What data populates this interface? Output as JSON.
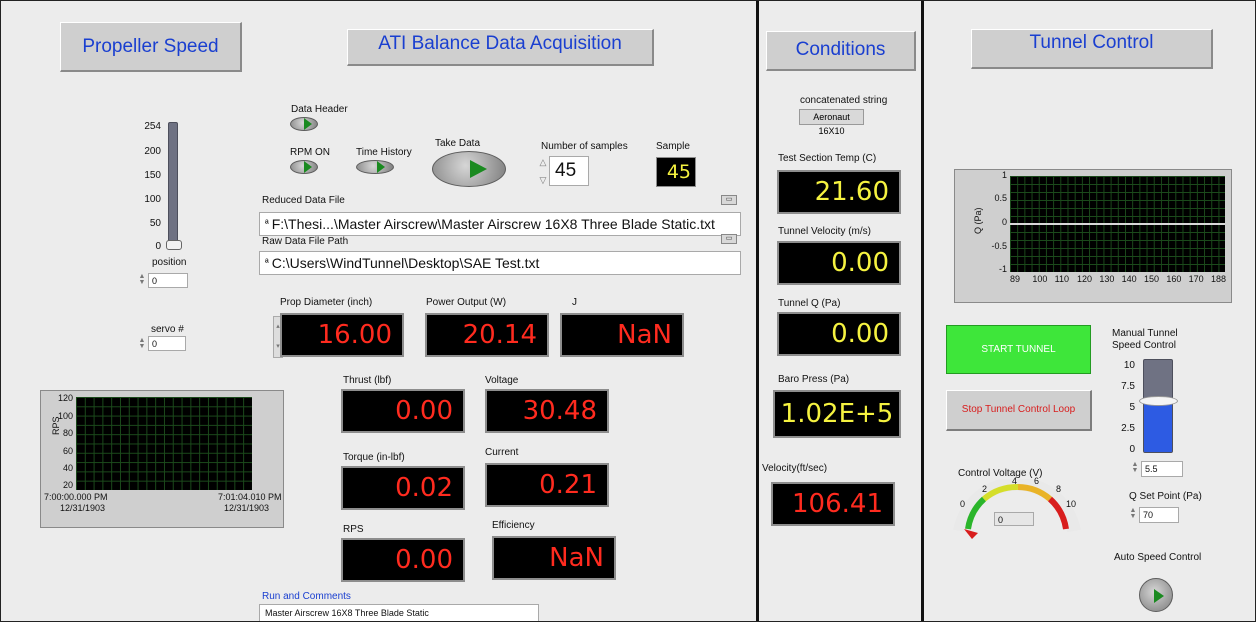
{
  "titles": {
    "propeller_speed": "Propeller Speed",
    "ati": "ATI Balance Data Acquisition",
    "conditions": "Conditions",
    "tunnel_control": "Tunnel Control"
  },
  "controls": {
    "data_header": "Data Header",
    "rpm_on": "RPM ON",
    "time_history": "Time History",
    "take_data": "Take Data",
    "num_samples_label": "Number of samples",
    "num_samples_value": "45",
    "sample_label": "Sample",
    "sample_value": "45"
  },
  "slider": {
    "ticks": [
      "254",
      "200",
      "150",
      "100",
      "50",
      "0"
    ],
    "label": "position",
    "value": "0",
    "level": 0
  },
  "servo": {
    "label": "servo #",
    "value": "0"
  },
  "files": {
    "reduced_label": "Reduced Data File",
    "reduced_prefix": "ª",
    "reduced_path": "F:\\Thesi...\\Master Airscrew\\Master Airscrew 16X8 Three Blade Static.txt",
    "raw_label": "Raw Data File  Path",
    "raw_prefix": "ª",
    "raw_path": "C:\\Users\\WindTunnel\\Desktop\\SAE Test.txt"
  },
  "readouts": {
    "prop_diameter": {
      "label": "Prop Diameter (inch)",
      "value": "16.00"
    },
    "power_output": {
      "label": "Power Output (W)",
      "value": "20.14"
    },
    "j": {
      "label": "J",
      "value": "NaN"
    },
    "thrust": {
      "label": "Thrust (lbf)",
      "value": "0.00"
    },
    "voltage": {
      "label": "Voltage",
      "value": "30.48"
    },
    "torque": {
      "label": "Torque (in-lbf)",
      "value": "0.02"
    },
    "current": {
      "label": "Current",
      "value": "0.21"
    },
    "rps": {
      "label": "RPS",
      "value": "0.00"
    },
    "efficiency": {
      "label": "Efficiency",
      "value": "NaN"
    }
  },
  "rps_graph": {
    "ylabel": "RPS",
    "yticks": [
      "120",
      "100",
      "80",
      "60",
      "40",
      "20"
    ],
    "xstart_time": "7:00:00.000 PM",
    "xstart_date": "12/31/1903",
    "xend_time": "7:01:04.010 PM",
    "xend_date": "12/31/1903"
  },
  "comments": {
    "label": "Run and Comments",
    "value": "Master Airscrew 16X8 Three Blade Static"
  },
  "conditions": {
    "concat_label": "concatenated string",
    "concat_value": "Aeronaut 16X10",
    "temp": {
      "label": "Test Section Temp (C)",
      "value": "21.60"
    },
    "velocity": {
      "label": "Tunnel Velocity  (m/s)",
      "value": "0.00"
    },
    "q": {
      "label": "Tunnel Q (Pa)",
      "value": "0.00"
    },
    "baro": {
      "label": "Baro Press (Pa)",
      "value": "1.02E+5"
    },
    "vel_fts": {
      "label": "Velocity(ft/sec)",
      "value": "106.41"
    }
  },
  "q_graph": {
    "ylabel": "Q (Pa)",
    "yticks": [
      "1",
      "0.5",
      "0",
      "-0.5",
      "-1"
    ],
    "xticks": [
      "89",
      "100",
      "110",
      "120",
      "130",
      "140",
      "150",
      "160",
      "170",
      "188"
    ]
  },
  "tunnel": {
    "start_label": "START TUNNEL",
    "stop_label": "Stop Tunnel Control Loop",
    "manual_label_1": "Manual Tunnel",
    "manual_label_2": "Speed Control",
    "manual_ticks": [
      "10",
      "7.5",
      "5",
      "2.5",
      "0"
    ],
    "manual_value": "5.5",
    "manual_level": 5.5,
    "qset_label": "Q Set Point (Pa)",
    "qset_value": "70",
    "control_voltage_label": "Control Voltage (V)",
    "gauge_ticks": [
      "0",
      "2",
      "4",
      "6",
      "8",
      "10"
    ],
    "gauge_value": "0",
    "auto_label": "Auto Speed Control"
  },
  "colors": {
    "display_red": "#ff2b1f",
    "display_yellow": "#f5f240",
    "title_blue": "#1a3fd0",
    "start_green": "#3ee63a",
    "stop_red": "#d81d1d"
  }
}
